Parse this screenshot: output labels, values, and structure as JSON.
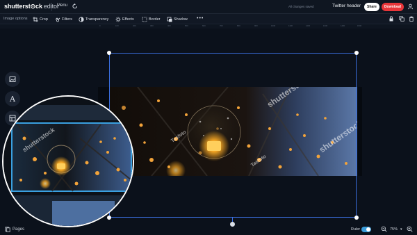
{
  "header": {
    "logo_main": "shutterst⊙ck",
    "logo_sub": "editor",
    "menu_label": "Menu",
    "saved_status": "All changes saved",
    "document_title": "Twitter header",
    "share_label": "Share",
    "download_label": "Download"
  },
  "toolbar": {
    "section_label": "Image options",
    "items": [
      {
        "label": "Crop",
        "icon": "crop-icon"
      },
      {
        "label": "Filters",
        "icon": "filters-icon"
      },
      {
        "label": "Transparency",
        "icon": "transparency-icon"
      },
      {
        "label": "Effects",
        "icon": "effects-icon"
      },
      {
        "label": "Border",
        "icon": "border-icon"
      },
      {
        "label": "Shadow",
        "icon": "shadow-icon"
      }
    ],
    "more_label": "•••"
  },
  "ruler": {
    "ticks": [
      "0",
      "100",
      "200",
      "300",
      "400",
      "500",
      "600",
      "700",
      "800",
      "900",
      "1000",
      "1100",
      "1200",
      "1300",
      "1400",
      "1500"
    ]
  },
  "side_tools": [
    {
      "name": "image-tool",
      "icon": "image-icon"
    },
    {
      "name": "text-tool",
      "label": "A"
    },
    {
      "name": "elements-tool",
      "icon": "elements-icon"
    }
  ],
  "canvas": {
    "watermark": "shutterstock",
    "photo_credit": "Tasfoto"
  },
  "footer": {
    "pages_label": "Pages",
    "ruler_label": "Ruler",
    "ruler_enabled": true,
    "zoom_value": "75%"
  },
  "colors": {
    "accent": "#3b6fe0",
    "download": "#e8363a",
    "toggle": "#3a9bd8",
    "background": "#0b111b"
  }
}
